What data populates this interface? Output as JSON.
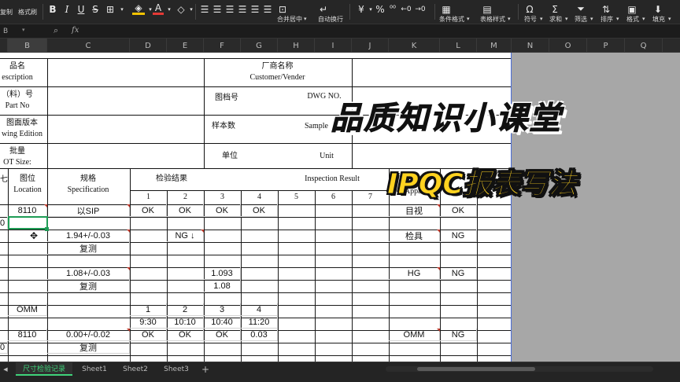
{
  "toolbar": {
    "format_painter_label": "格式刷",
    "copy_label": "复制",
    "merge_center_label": "合并居中",
    "auto_wrap_label": "自动换行",
    "conditional_format_label": "条件格式",
    "table_style_label": "表格样式",
    "symbol_label": "符号",
    "sum_label": "求和",
    "filter_label": "筛选",
    "sort_label": "排序",
    "format_label": "格式",
    "fill_label": "填充",
    "bold_label": "B",
    "percent_label": "%"
  },
  "formula_bar": {
    "name_box": "B",
    "fx_label": "fx"
  },
  "columns": [
    "B",
    "C",
    "D",
    "E",
    "F",
    "G",
    "H",
    "I",
    "J",
    "K",
    "L",
    "M",
    "N",
    "O",
    "P",
    "Q"
  ],
  "header_labels": {
    "product_name": "品名",
    "product_name_en": "escription",
    "part_no": "（料）号",
    "part_no_en": "Part No",
    "drawing_edition": "图面版本",
    "drawing_edition_en": "wing Edition",
    "lot": "批量",
    "lot_en": "OT Size:",
    "vendor": "厂商名称",
    "vendor_en": "Customer/Vender",
    "dwg_no": "图档号",
    "dwg_no_en": "DWG NO.",
    "sample": "样本数",
    "sample_en": "Sample",
    "unit": "单位",
    "unit_en": "Unit",
    "location": "图位",
    "location_en": "Location",
    "spec": "规格",
    "spec_en": "Specification",
    "inspection": "检验结果",
    "inspection_en": "Inspection Result",
    "apparatus_en": "Apparat",
    "sample_nums": [
      "1",
      "2",
      "3",
      "4",
      "5",
      "6",
      "7"
    ]
  },
  "rows": {
    "r1": {
      "loc": "8110",
      "spec": "以SIP",
      "d": "OK",
      "e": "OK",
      "f": "OK",
      "g": "OK",
      "k": "目视",
      "l": "OK"
    },
    "r2": {
      "b_edge": "0"
    },
    "r3": {
      "spec": "1.94+/-0.03",
      "e": "NG ↓",
      "k": "检具",
      "l": "NG"
    },
    "r4": {
      "spec": "复测"
    },
    "r5": {
      "spec": "1.08+/-0.03",
      "f": "1.093",
      "k": "HG",
      "l": "NG"
    },
    "r6": {
      "spec": "复测",
      "f": "1.08"
    },
    "r7": {
      "loc": "OMM",
      "d": "1",
      "e": "2",
      "f": "3",
      "g": "4"
    },
    "r8": {
      "d": "9:30",
      "e": "10:10",
      "f": "10:40",
      "g": "11:20"
    },
    "r9": {
      "loc": "8110",
      "spec": "0.00+/-0.02",
      "d": "OK",
      "e": "OK",
      "f": "OK",
      "g": "0.03",
      "k": "OMM",
      "l": "NG"
    },
    "r10": {
      "b_edge": "0",
      "spec": "复测"
    }
  },
  "sheet_tabs": [
    "尺寸检验记录",
    "Sheet1",
    "Sheet2",
    "Sheet3"
  ],
  "add_sheet_label": "+",
  "overlay": {
    "title": "品质知识小课堂",
    "subtitle": "IPQC报表写法"
  }
}
